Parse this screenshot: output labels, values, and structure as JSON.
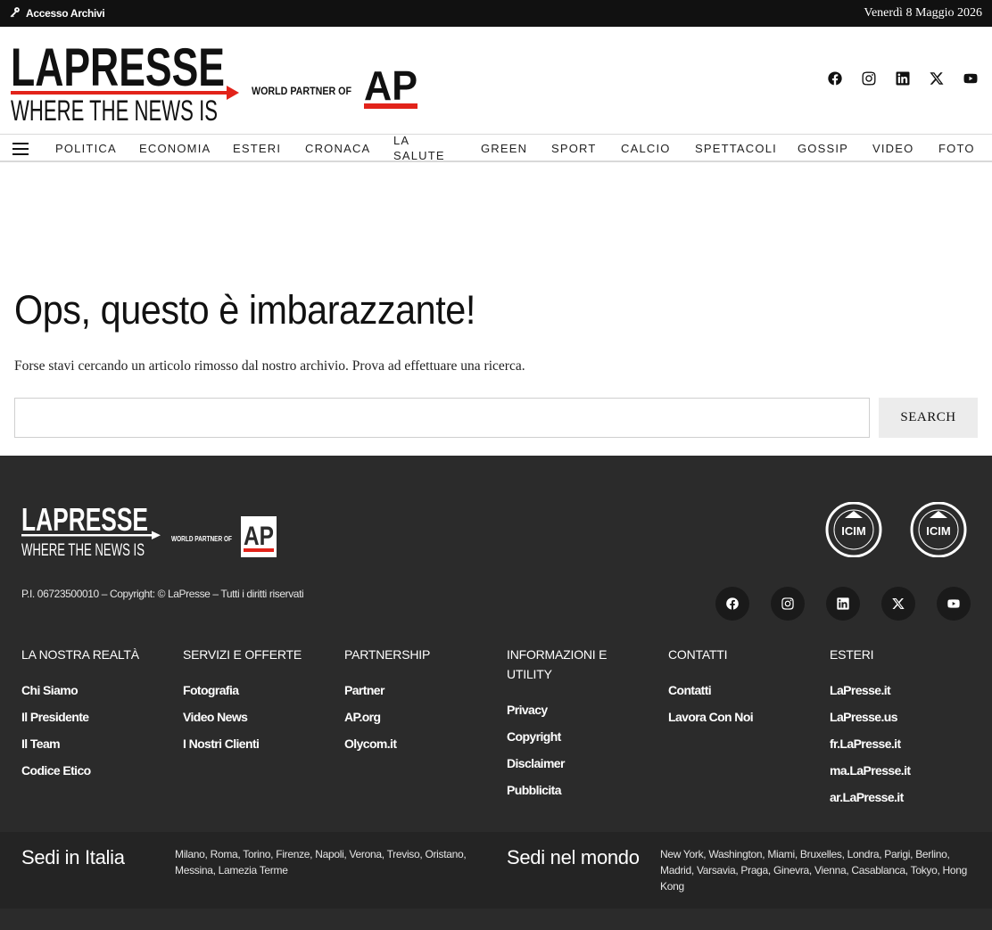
{
  "topbar": {
    "archivi_label": "Accesso Archivi",
    "date": "Venerdì 8 Maggio 2026"
  },
  "brand": {
    "name": "LAPRESSE",
    "tagline": "WHERE THE NEWS IS",
    "partner_text": "WORLD PARTNER OF",
    "partner_name": "AP",
    "accent": "#e2231a"
  },
  "social": [
    {
      "name": "facebook-icon"
    },
    {
      "name": "instagram-icon"
    },
    {
      "name": "linkedin-icon"
    },
    {
      "name": "x-icon"
    },
    {
      "name": "youtube-icon"
    }
  ],
  "nav": {
    "items": [
      "POLITICA",
      "ECONOMIA",
      "ESTERI",
      "CRONACA",
      "LA SALUTE",
      "GREEN",
      "SPORT",
      "CALCIO",
      "SPETTACOLI",
      "GOSSIP",
      "VIDEO",
      "FOTO"
    ]
  },
  "main": {
    "title": "Ops, questo è imbarazzante!",
    "subtitle": "Forse stavi cercando un articolo rimosso dal nostro archivio. Prova ad effettuare una ricerca.",
    "search_value": "",
    "search_button": "SEARCH"
  },
  "footer": {
    "certs": [
      "ICIM",
      "ICIM"
    ],
    "pi": "P.I. 06723500010 – Copyright: © LaPresse – Tutti i diritti riservati",
    "columns": [
      {
        "title": "LA NOSTRA REALTÀ",
        "links": [
          "Chi Siamo",
          "Il Presidente",
          "Il Team",
          "Codice Etico"
        ]
      },
      {
        "title": "SERVIZI E OFFERTE",
        "links": [
          "Fotografia",
          "Video News",
          "I Nostri Clienti"
        ]
      },
      {
        "title": "PARTNERSHIP",
        "links": [
          "Partner",
          "AP.org",
          "Olycom.it"
        ]
      },
      {
        "title": "INFORMAZIONI E UTILITY",
        "links": [
          "Privacy",
          "Copyright",
          "Disclaimer",
          "Pubblicita"
        ]
      },
      {
        "title": "CONTATTI",
        "links": [
          "Contatti",
          "Lavora Con Noi"
        ]
      },
      {
        "title": "ESTERI",
        "links": [
          "LaPresse.it",
          "LaPresse.us",
          "fr.LaPresse.it",
          "ma.LaPresse.it",
          "ar.LaPresse.it"
        ]
      }
    ],
    "sedi_italia_title": "Sedi in Italia",
    "sedi_italia": "Milano, Roma, Torino, Firenze, Napoli, Verona, Treviso, Oristano, Messina, Lamezia Terme",
    "sedi_mondo_title": "Sedi nel mondo",
    "sedi_mondo": "New York, Washington, Miami, Bruxelles, Londra, Parigi, Berlino, Madrid, Varsavia, Praga, Ginevra, Vienna, Casablanca, Tokyo, Hong Kong"
  }
}
